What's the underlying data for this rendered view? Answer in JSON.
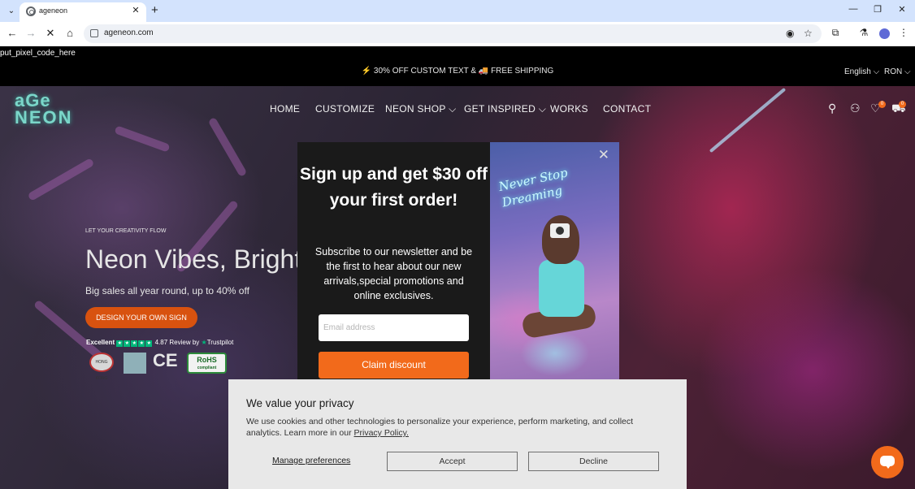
{
  "browser": {
    "tab_title": "ageneon",
    "url": "ageneon.com",
    "icons": {
      "tab_list": "chevron-down-icon",
      "close_tab": "close-icon",
      "new_tab": "plus-icon",
      "minimize": "minimize-icon",
      "restore": "restore-icon",
      "close_window": "close-icon",
      "back": "back-arrow-icon",
      "forward": "forward-arrow-icon",
      "reload": "stop-loading-icon",
      "home": "home-icon",
      "site_info": "site-info-icon",
      "eye_off": "eye-off-icon",
      "bookmark": "star-icon",
      "extensions": "puzzle-icon",
      "labs": "flask-icon",
      "profile": "profile-avatar-icon",
      "menu": "kebab-menu-icon"
    }
  },
  "page": {
    "pixel_code": "put_pixel_code_here",
    "announcement": "⚡ 30% OFF CUSTOM TEXT & 🚚 FREE SHIPPING",
    "language": "English ⌵",
    "currency": "RON ⌵",
    "logo_line1": "aGe",
    "logo_line2": "NEON",
    "nav": {
      "home": "HOME",
      "customize": "CUSTOMIZE",
      "neon_shop": "NEON SHOP ⌵",
      "get_inspired": "GET INSPIRED ⌵",
      "works": "WORKS",
      "contact": "CONTACT"
    },
    "header_icons": {
      "search": "search-icon",
      "account": "user-icon",
      "wishlist": "heart-icon",
      "cart": "cart-icon",
      "wishlist_count": "0",
      "cart_count": "0"
    },
    "hero": {
      "tagline": "LET YOUR CREATIVITY FLOW",
      "title": "Neon Vibes, Bright",
      "subtitle": "Big sales all year round, up to 40% off",
      "cta": "DESIGN YOUR OWN SIGN",
      "trust_excellent": "Excellent",
      "trust_rating": "4.87 Review by",
      "trust_brand": "Trustpilot"
    },
    "certifications": {
      "hk": "HONG KONG",
      "ce": "CE",
      "rohs": "RoHS",
      "rohs_sub": "compliant"
    }
  },
  "popup": {
    "heading": "Sign up and get $30 off your first order!",
    "body": "Subscribe to our newsletter and be the first to hear about our new arrivals,special promotions and online exclusives.",
    "email_placeholder": "Email address",
    "button": "Claim discount",
    "neon_text_line1": "Never Stop",
    "neon_text_line2": "Dreaming"
  },
  "privacy": {
    "title": "We value your privacy",
    "text": "We use cookies and other technologies to personalize your experience, perform marketing, and collect analytics. Learn more in our ",
    "link": "Privacy Policy.",
    "manage": "Manage preferences",
    "accept": "Accept",
    "decline": "Decline"
  }
}
